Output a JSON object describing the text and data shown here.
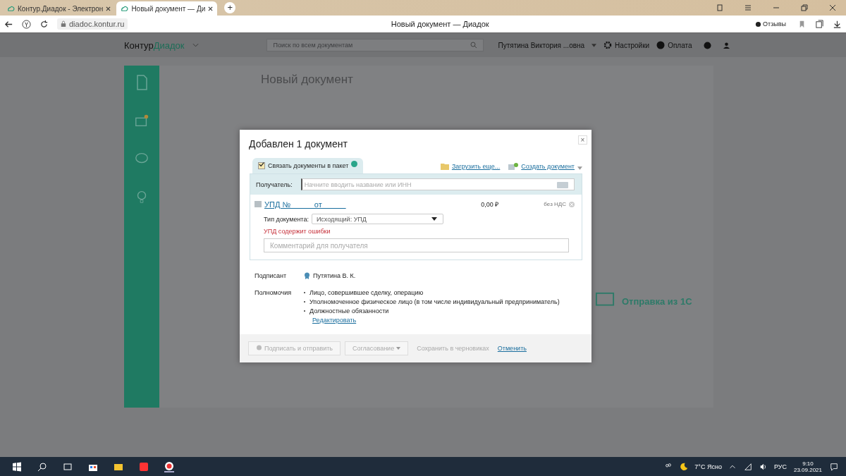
{
  "browser": {
    "tabs": [
      {
        "title": "Контур.Диадок - Электрон",
        "selected": false
      },
      {
        "title": "Новый документ — Ди",
        "selected": true
      }
    ],
    "new_tab": "+",
    "url": "diadoc.kontur.ru",
    "page_title": "Новый документ — Диадок",
    "feedback": "Отзывы"
  },
  "header": {
    "logo_left": "Контур",
    "logo_right": "Диадок",
    "search_placeholder": "Поиск по всем документам",
    "user": "Путятина Виктория ...овна",
    "settings": "Настройки",
    "payment": "Оплата"
  },
  "page": {
    "heading": "Новый документ",
    "promo_title": "Отправка из 1С"
  },
  "dialog": {
    "title": "Добавлен 1 документ",
    "close": "×",
    "package": {
      "label": "Связать документы в пакет",
      "checked": true
    },
    "upload_link": "Загрузить еще...",
    "create_link": "Создать документ",
    "recipient_label": "Получатель:",
    "recipient_placeholder": "Начните вводить название или ИНН",
    "document": {
      "title": "УПД №_____ от _____",
      "amount": "0,00 ₽",
      "vat": "без НДС",
      "type_label": "Тип документа:",
      "type_value": "Исходящий: УПД",
      "error": "УПД содержит ошибки",
      "comment_placeholder": "Комментарий для получателя"
    },
    "signer_label": "Подписант",
    "signer": "Путятина В. К.",
    "powers_label": "Полномочия",
    "powers": [
      "Лицо, совершившее сделку, операцию",
      "Уполномоченное физическое лицо (в том числе индивидуальный предприниматель)",
      "Должностные обязанности"
    ],
    "edit_link": "Редактировать",
    "buttons": [
      {
        "kind": "sign",
        "label": "Подписать и отправить",
        "disabled": true
      },
      {
        "kind": "dropdown",
        "label": "Согласование",
        "disabled": true
      },
      {
        "kind": "plain",
        "label": "Сохранить в черновиках",
        "disabled": true
      },
      {
        "kind": "link",
        "label": "Отменить",
        "disabled": false
      }
    ]
  },
  "taskbar": {
    "weather": "7°C Ясно",
    "lang": "РУС",
    "time": "9:10",
    "date": "23.09.2021"
  }
}
